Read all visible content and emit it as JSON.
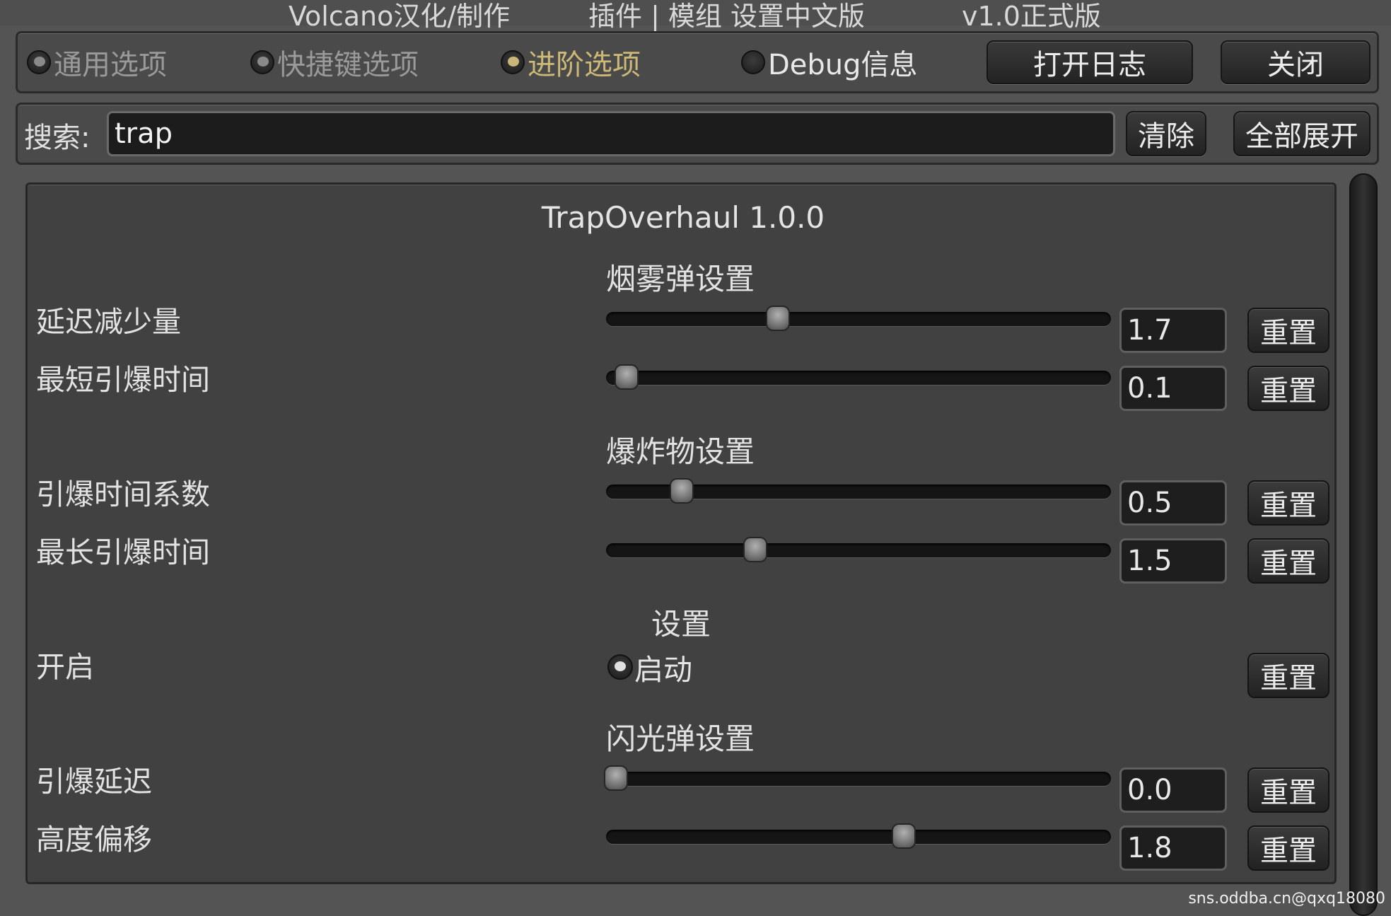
{
  "title_bar": {
    "seg1": "Volcano汉化/制作",
    "seg2": "插件 | 模组  设置中文版",
    "seg3": "v1.0正式版"
  },
  "tabs": [
    {
      "label": "通用选项",
      "state": "off"
    },
    {
      "label": "快捷键选项",
      "state": "off"
    },
    {
      "label": "进阶选项",
      "state": "active"
    },
    {
      "label": "Debug信息",
      "state": "off"
    }
  ],
  "toolbar": {
    "open_log": "打开日志",
    "close": "关闭"
  },
  "search": {
    "label": "搜索:",
    "value": "trap",
    "clear": "清除",
    "expand_all": "全部展开"
  },
  "mod": {
    "title": "TrapOverhaul 1.0.0",
    "sections": [
      {
        "title": "烟雾弹设置",
        "rows": [
          {
            "label": "延迟减少量",
            "type": "slider",
            "value": "1.7",
            "fraction": 0.34
          },
          {
            "label": "最短引爆时间",
            "type": "slider",
            "value": "0.1",
            "fraction": 0.04
          }
        ]
      },
      {
        "title": "爆炸物设置",
        "rows": [
          {
            "label": "引爆时间系数",
            "type": "slider",
            "value": "0.5",
            "fraction": 0.15
          },
          {
            "label": "最长引爆时间",
            "type": "slider",
            "value": "1.5",
            "fraction": 0.295
          }
        ]
      },
      {
        "title": "设置",
        "rows": [
          {
            "label": "开启",
            "type": "toggle",
            "toggle_label": "启动",
            "checked": true
          }
        ]
      },
      {
        "title": "闪光弹设置",
        "rows": [
          {
            "label": "引爆延迟",
            "type": "slider",
            "value": "0.0",
            "fraction": 0.02
          },
          {
            "label": "高度偏移",
            "type": "slider",
            "value": "1.8",
            "fraction": 0.59
          }
        ]
      }
    ],
    "reset_label": "重置"
  },
  "watermark": "sns.oddba.cn@qxq18080"
}
